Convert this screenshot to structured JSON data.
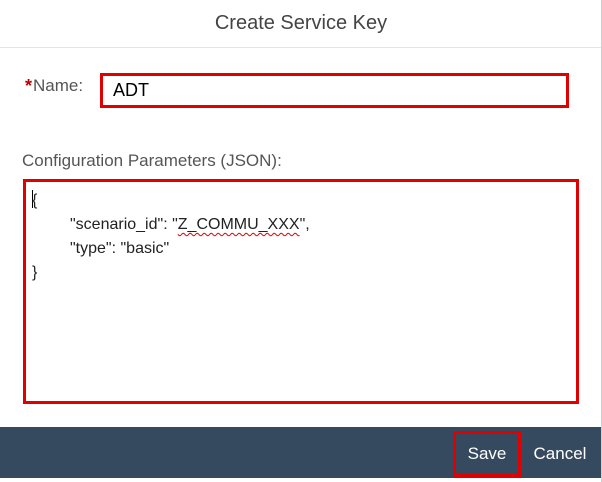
{
  "dialog": {
    "title": "Create Service Key"
  },
  "form": {
    "name_required_mark": "*",
    "name_label": "Name:",
    "name_value": "ADT",
    "config_label": "Configuration Parameters (JSON):",
    "json": {
      "open_brace": "{",
      "line1_key": "\"scenario_id\": \"",
      "line1_value": "Z_COMMU_XXX",
      "line1_end": "\",",
      "line2": "\"type\": \"basic\"",
      "close_brace": "}"
    }
  },
  "footer": {
    "save_label": "Save",
    "cancel_label": "Cancel"
  },
  "colors": {
    "footer_bg": "#354a5f",
    "highlight": "#e00000",
    "required": "#bb0000"
  }
}
